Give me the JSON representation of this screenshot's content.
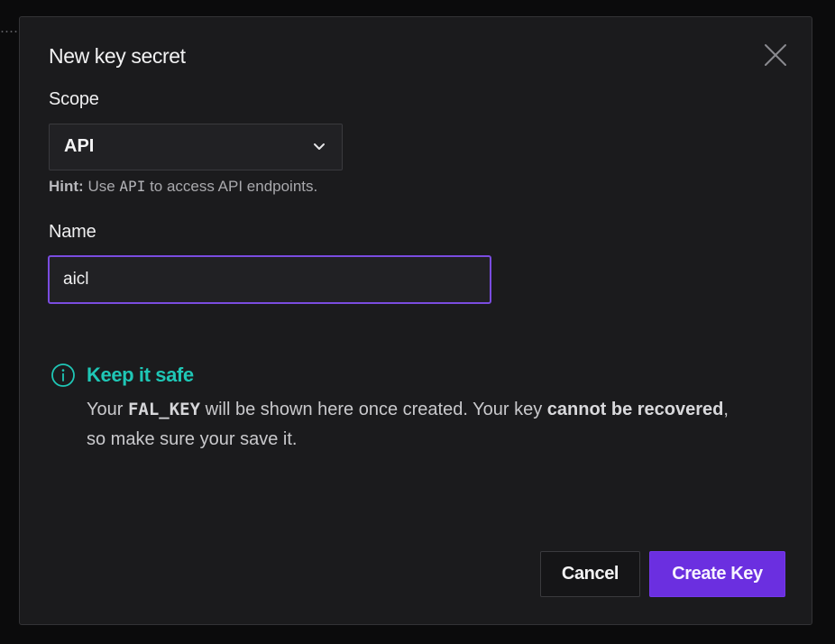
{
  "dialog": {
    "title": "New key secret",
    "close_icon": "close-icon"
  },
  "scope": {
    "label": "Scope",
    "selected": "API",
    "hint_prefix": "Hint:",
    "hint_use": "Use",
    "hint_code": "API",
    "hint_suffix": "to access API endpoints."
  },
  "name": {
    "label": "Name",
    "value": "aicl"
  },
  "notice": {
    "icon": "info-icon",
    "title": "Keep it safe",
    "text_1": "Your",
    "code": "FAL_KEY",
    "text_2": "will be shown here once created. Your key",
    "bold_1": "cannot be recovered",
    "text_3": ", so make sure your save it."
  },
  "actions": {
    "cancel_label": "Cancel",
    "create_label": "Create Key"
  },
  "colors": {
    "accent": "#6b2fe0",
    "focus_border": "#7a4ce0",
    "notice_teal": "#1fc7b6",
    "modal_bg": "#1b1b1d"
  }
}
